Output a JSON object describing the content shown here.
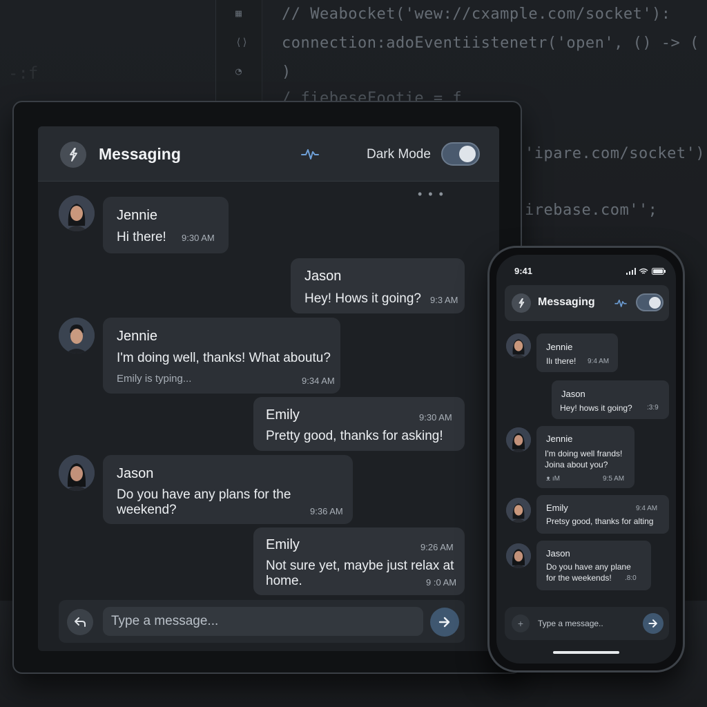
{
  "background_code": {
    "lines": [
      "// Weabocket('wew://cxample.com/socket'):",
      "connection:adoEventiistenetr('open', () -> (",
      ")",
      "/ fiebeseFootie = f",
      "'ipare.com/socket');",
      "irebase.com'';"
    ]
  },
  "tablet": {
    "header": {
      "title": "Messaging",
      "dark_mode_label": "Dark Mode",
      "dark_mode_on": true
    },
    "messages": [
      {
        "side": "left",
        "name": "Jennie",
        "text": "Hi there!",
        "time": "9:30 AM"
      },
      {
        "side": "right",
        "name": "Jason",
        "text": "Hey! Hows it going?",
        "time": "9:3 AM"
      },
      {
        "side": "left",
        "name": "Jennie",
        "text": "I'm doing well, thanks! What aboutu?",
        "typing": "Emily is typing...",
        "time": "9:34 AM"
      },
      {
        "side": "right",
        "name": "Emily",
        "text": "Pretty good, thanks for asking!",
        "time": "9:30 AM"
      },
      {
        "side": "left",
        "name": "Jason",
        "text_line1": "Do you have any plans for the",
        "text_line2": "weekend?",
        "time": "9:36 AM"
      },
      {
        "side": "right",
        "name": "Emily",
        "text_line1": "Not sure yet, maybe just relax at",
        "text_line2": "home.",
        "time_top": "9:26 AM",
        "time": "9 :0 AM"
      }
    ],
    "input": {
      "placeholder": "Type a message..."
    }
  },
  "phone": {
    "status_time": "9:41",
    "header": {
      "title": "Messaging",
      "dark_mode_on": true
    },
    "messages": [
      {
        "name": "Jennie",
        "text": "Ilı there!",
        "time": "9:4 AM"
      },
      {
        "name": "Jason",
        "text": "Hey! hows it going?",
        "time": ":3:9"
      },
      {
        "name": "Jennie",
        "text_line1": "I'm doing well frands!",
        "text_line2": "Joina about you?",
        "time_left": "ᴥ ıM",
        "time": "9:5 AM"
      },
      {
        "name": "Emily",
        "text": "Pretsy good, thanks for alting",
        "time": "9:4 AM"
      },
      {
        "name": "Jason",
        "text_line1": "Do you have any plane",
        "text_line2": "for the weekends!",
        "time": ".8:0"
      }
    ],
    "input": {
      "placeholder": "Type a message.."
    }
  },
  "colors": {
    "accent": "#3f5770",
    "wave": "#6ea0d8",
    "bubble": "#2c3036",
    "screen": "#1d2024"
  },
  "icons": {
    "logo": "bolt-icon",
    "activity": "waveform-icon",
    "reply": "reply-arrow-icon",
    "send": "arrow-right-icon",
    "attach": "plus-icon"
  }
}
